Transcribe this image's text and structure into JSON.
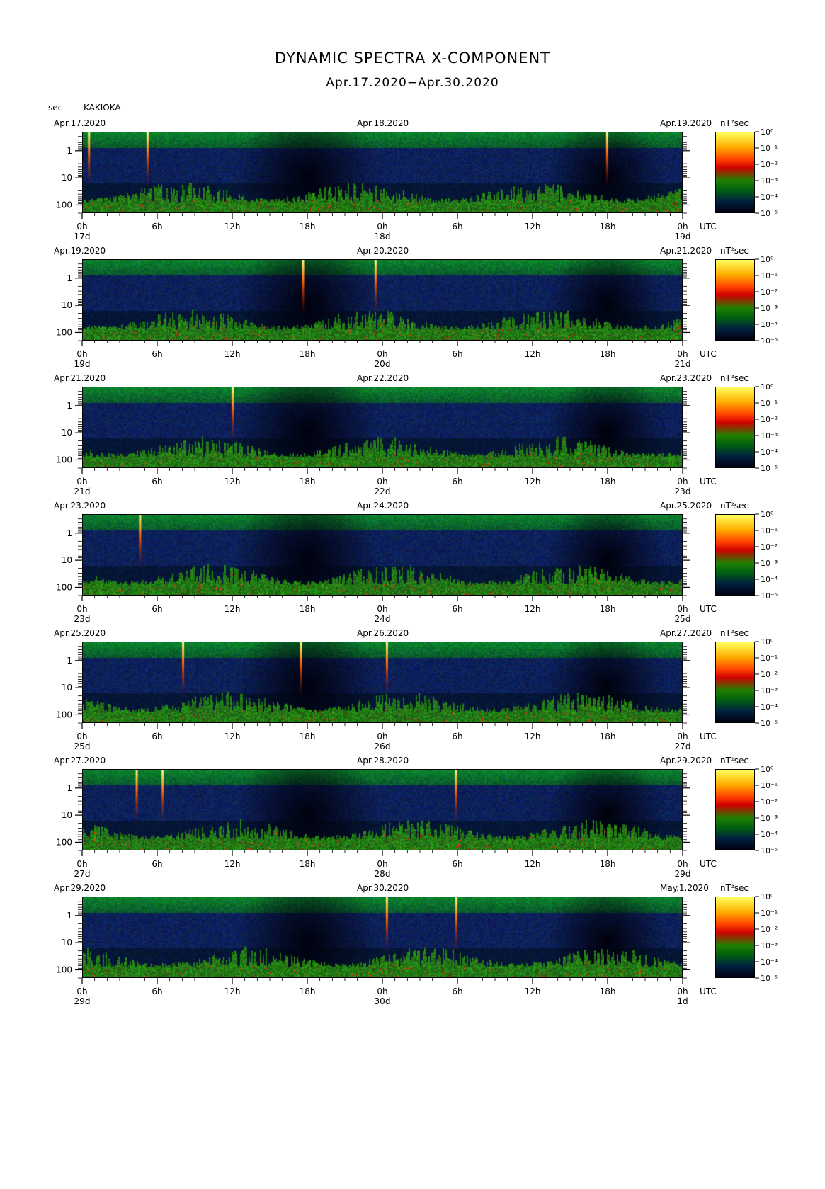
{
  "title": "DYNAMIC SPECTRA X-COMPONENT",
  "subtitle": "Apr.17.2020−Apr.30.2020",
  "unit_label": "sec",
  "station": "KAKIOKA",
  "colorbar_unit": "nT²sec",
  "utc_label": "UTC",
  "chart_data": [
    {
      "type": "heatmap",
      "start_date": "Apr.17.2020",
      "mid_date": "Apr.18.2020",
      "end_date": "Apr.19.2020",
      "day_start": "17d",
      "day_mid": "18d",
      "day_end": "19d",
      "x_ticks": [
        "0h",
        "6h",
        "12h",
        "18h",
        "0h",
        "6h",
        "12h",
        "18h",
        "0h"
      ],
      "y_ticks": [
        "1",
        "10",
        "100"
      ],
      "y_scale": "log",
      "y_unit": "sec",
      "colorbar_ticks": [
        "10⁰",
        "10⁻¹",
        "10⁻²",
        "10⁻³",
        "10⁻⁴",
        "10⁻⁵"
      ]
    },
    {
      "type": "heatmap",
      "start_date": "Apr.19.2020",
      "mid_date": "Apr.20.2020",
      "end_date": "Apr.21.2020",
      "day_start": "19d",
      "day_mid": "20d",
      "day_end": "21d",
      "x_ticks": [
        "0h",
        "6h",
        "12h",
        "18h",
        "0h",
        "6h",
        "12h",
        "18h",
        "0h"
      ],
      "y_ticks": [
        "1",
        "10",
        "100"
      ],
      "y_scale": "log",
      "y_unit": "sec",
      "colorbar_ticks": [
        "10⁰",
        "10⁻¹",
        "10⁻²",
        "10⁻³",
        "10⁻⁴",
        "10⁻⁵"
      ]
    },
    {
      "type": "heatmap",
      "start_date": "Apr.21.2020",
      "mid_date": "Apr.22.2020",
      "end_date": "Apr.23.2020",
      "day_start": "21d",
      "day_mid": "22d",
      "day_end": "23d",
      "x_ticks": [
        "0h",
        "6h",
        "12h",
        "18h",
        "0h",
        "6h",
        "12h",
        "18h",
        "0h"
      ],
      "y_ticks": [
        "1",
        "10",
        "100"
      ],
      "y_scale": "log",
      "y_unit": "sec",
      "colorbar_ticks": [
        "10⁰",
        "10⁻¹",
        "10⁻²",
        "10⁻³",
        "10⁻⁴",
        "10⁻⁵"
      ]
    },
    {
      "type": "heatmap",
      "start_date": "Apr.23.2020",
      "mid_date": "Apr.24.2020",
      "end_date": "Apr.25.2020",
      "day_start": "23d",
      "day_mid": "24d",
      "day_end": "25d",
      "x_ticks": [
        "0h",
        "6h",
        "12h",
        "18h",
        "0h",
        "6h",
        "12h",
        "18h",
        "0h"
      ],
      "y_ticks": [
        "1",
        "10",
        "100"
      ],
      "y_scale": "log",
      "y_unit": "sec",
      "colorbar_ticks": [
        "10⁰",
        "10⁻¹",
        "10⁻²",
        "10⁻³",
        "10⁻⁴",
        "10⁻⁵"
      ]
    },
    {
      "type": "heatmap",
      "start_date": "Apr.25.2020",
      "mid_date": "Apr.26.2020",
      "end_date": "Apr.27.2020",
      "day_start": "25d",
      "day_mid": "26d",
      "day_end": "27d",
      "x_ticks": [
        "0h",
        "6h",
        "12h",
        "18h",
        "0h",
        "6h",
        "12h",
        "18h",
        "0h"
      ],
      "y_ticks": [
        "1",
        "10",
        "100"
      ],
      "y_scale": "log",
      "y_unit": "sec",
      "colorbar_ticks": [
        "10⁰",
        "10⁻¹",
        "10⁻²",
        "10⁻³",
        "10⁻⁴",
        "10⁻⁵"
      ]
    },
    {
      "type": "heatmap",
      "start_date": "Apr.27.2020",
      "mid_date": "Apr.28.2020",
      "end_date": "Apr.29.2020",
      "day_start": "27d",
      "day_mid": "28d",
      "day_end": "29d",
      "x_ticks": [
        "0h",
        "6h",
        "12h",
        "18h",
        "0h",
        "6h",
        "12h",
        "18h",
        "0h"
      ],
      "y_ticks": [
        "1",
        "10",
        "100"
      ],
      "y_scale": "log",
      "y_unit": "sec",
      "colorbar_ticks": [
        "10⁰",
        "10⁻¹",
        "10⁻²",
        "10⁻³",
        "10⁻⁴",
        "10⁻⁵"
      ]
    },
    {
      "type": "heatmap",
      "start_date": "Apr.29.2020",
      "mid_date": "Apr.30.2020",
      "end_date": "May.1.2020",
      "day_start": "29d",
      "day_mid": "30d",
      "day_end": "1d",
      "x_ticks": [
        "0h",
        "6h",
        "12h",
        "18h",
        "0h",
        "6h",
        "12h",
        "18h",
        "0h"
      ],
      "y_ticks": [
        "1",
        "10",
        "100"
      ],
      "y_scale": "log",
      "y_unit": "sec",
      "colorbar_ticks": [
        "10⁰",
        "10⁻¹",
        "10⁻²",
        "10⁻³",
        "10⁻⁴",
        "10⁻⁵"
      ]
    }
  ]
}
